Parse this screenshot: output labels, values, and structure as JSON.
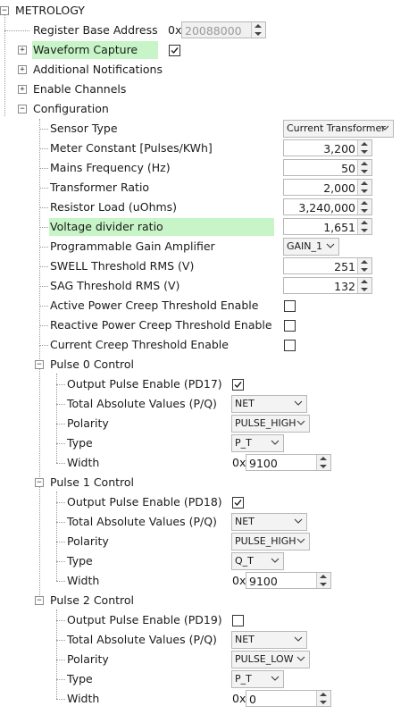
{
  "root": {
    "label": "METROLOGY"
  },
  "register": {
    "label": "Register Base Address",
    "prefix": "0x",
    "value": "20088000"
  },
  "waveform": {
    "label": "Waveform Capture",
    "checked": true
  },
  "additional": {
    "label": "Additional Notifications"
  },
  "channels": {
    "label": "Enable Channels"
  },
  "config": {
    "label": "Configuration",
    "sensor_type": {
      "label": "Sensor Type",
      "value": "Current Transformer"
    },
    "meter_constant": {
      "label": "Meter Constant [Pulses/KWh]",
      "value": "3,200"
    },
    "mains_freq": {
      "label": "Mains Frequency (Hz)",
      "value": "50"
    },
    "transformer_ratio": {
      "label": "Transformer Ratio",
      "value": "2,000"
    },
    "resistor_load": {
      "label": "Resistor Load (uOhms)",
      "value": "3,240,000"
    },
    "voltage_divider": {
      "label": "Voltage divider ratio",
      "value": "1,651"
    },
    "pga": {
      "label": "Programmable Gain Amplifier",
      "value": "GAIN_1"
    },
    "swell": {
      "label": "SWELL Threshold RMS (V)",
      "value": "251"
    },
    "sag": {
      "label": "SAG Threshold RMS (V)",
      "value": "132"
    },
    "active_creep": {
      "label": "Active Power Creep Threshold Enable",
      "checked": false
    },
    "reactive_creep": {
      "label": "Reactive Power Creep Threshold Enable",
      "checked": false
    },
    "current_creep": {
      "label": "Current Creep Threshold Enable",
      "checked": false
    }
  },
  "pulses": [
    {
      "label": "Pulse 0 Control",
      "output_label": "Output Pulse Enable (PD17)",
      "output_checked": true,
      "total_label": "Total Absolute Values (P/Q)",
      "total_value": "NET",
      "polarity_label": "Polarity",
      "polarity_value": "PULSE_HIGH",
      "type_label": "Type",
      "type_value": "P_T",
      "width_label": "Width",
      "width_prefix": "0x",
      "width_value": "9100"
    },
    {
      "label": "Pulse 1 Control",
      "output_label": "Output Pulse Enable (PD18)",
      "output_checked": true,
      "total_label": "Total Absolute Values (P/Q)",
      "total_value": "NET",
      "polarity_label": "Polarity",
      "polarity_value": "PULSE_HIGH",
      "type_label": "Type",
      "type_value": "Q_T",
      "width_label": "Width",
      "width_prefix": "0x",
      "width_value": "9100"
    },
    {
      "label": "Pulse 2 Control",
      "output_label": "Output Pulse Enable (PD19)",
      "output_checked": false,
      "total_label": "Total Absolute Values (P/Q)",
      "total_value": "NET",
      "polarity_label": "Polarity",
      "polarity_value": "PULSE_LOW",
      "type_label": "Type",
      "type_value": "P_T",
      "width_label": "Width",
      "width_prefix": "0x",
      "width_value": "0"
    }
  ],
  "icons": {
    "expand": "plus-box-icon",
    "collapse": "minus-box-icon",
    "check": "checkmark-icon",
    "dropdown": "chevron-down-icon",
    "spinner": "spin-arrows-icon"
  },
  "colors": {
    "highlight": "#c7f5c7"
  }
}
